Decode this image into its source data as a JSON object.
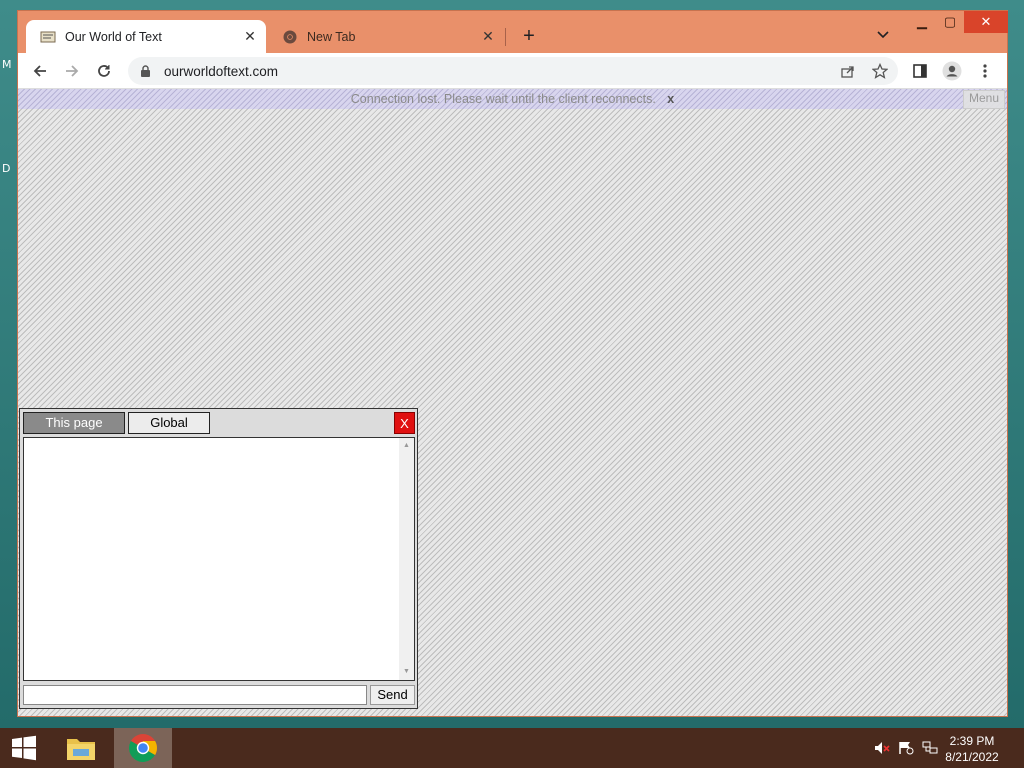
{
  "desktop": {
    "letters": [
      "M",
      "D"
    ]
  },
  "browser": {
    "tabs": [
      {
        "title": "Our World of Text",
        "active": true
      },
      {
        "title": "New Tab",
        "active": false
      }
    ],
    "address": {
      "url": "ourworldoftext.com"
    }
  },
  "page": {
    "connection_banner": "Connection lost. Please wait until the client reconnects.",
    "connection_close": "x",
    "menu_label": "Menu"
  },
  "chat": {
    "tab_this_page": "This page",
    "tab_global": "Global",
    "close_label": "X",
    "input_value": "",
    "send_label": "Send"
  },
  "taskbar": {
    "time": "2:39 PM",
    "date": "8/21/2022"
  },
  "colors": {
    "window_frame": "#e9906a",
    "close_red": "#e01010",
    "taskbar": "#4a2a1d"
  }
}
